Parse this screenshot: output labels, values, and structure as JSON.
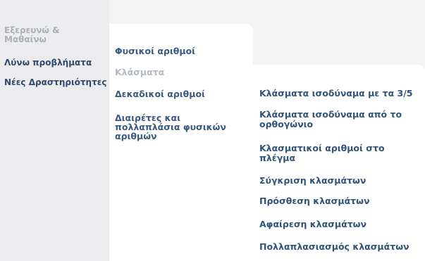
{
  "left_menu": {
    "items": [
      {
        "label": "Εξερευνώ & Μαθαίνω"
      },
      {
        "label": "Λύνω προβλήματα"
      },
      {
        "label": "Νέες Δραστηριότητες"
      }
    ]
  },
  "middle_menu": {
    "items": [
      {
        "label": "Φυσικοί αριθμοί"
      },
      {
        "label": "Κλάσματα"
      },
      {
        "label": "Δεκαδικοί αριθμοί"
      },
      {
        "label": "Διαιρέτες και πολλαπλάσια φυσικών αριθμών"
      }
    ]
  },
  "right_menu": {
    "items": [
      {
        "label": "Κλάσματα ισοδύναμα με τα 3/5"
      },
      {
        "label": "Κλάσματα ισοδύναμα από το ορθογώνιο"
      },
      {
        "label": "Κλασματικοί αριθμοί στο πλέγμα"
      },
      {
        "label": "Σύγκριση κλασμάτων"
      },
      {
        "label": "Πρόσθεση κλασμάτων"
      },
      {
        "label": "Αφαίρεση κλασμάτων"
      },
      {
        "label": "Πολλαπλασιασμός κλασμάτων"
      }
    ]
  }
}
